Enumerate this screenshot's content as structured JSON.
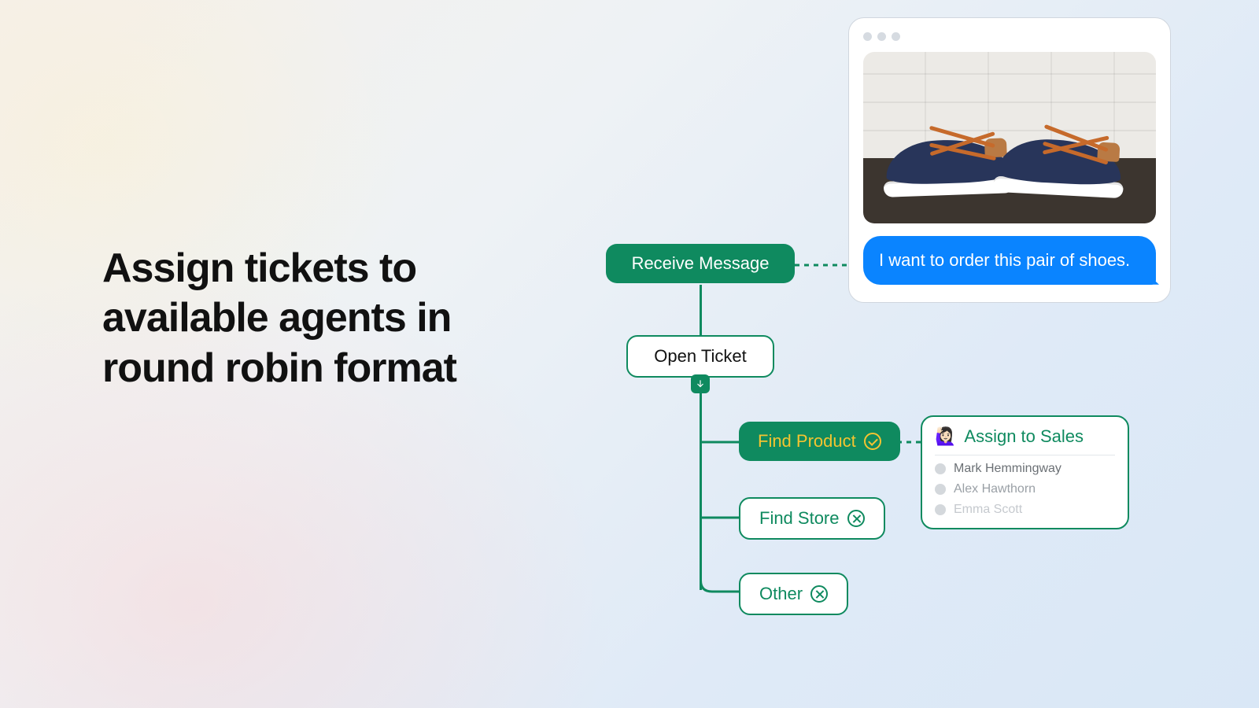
{
  "headline": "Assign tickets to available agents in round robin format",
  "chat": {
    "image_alt": "pair of navy canvas sneakers",
    "message": "I want to order this pair of shoes."
  },
  "flow": {
    "receive": "Receive Message",
    "open_ticket": "Open Ticket",
    "find_product": "Find Product",
    "find_store": "Find Store",
    "other": "Other"
  },
  "assign": {
    "title": "Assign to Sales",
    "emoji": "🙋🏻‍♀️",
    "agents": [
      "Mark Hemmingway",
      "Alex Hawthorn",
      "Emma Scott"
    ]
  },
  "colors": {
    "brand_green": "#0f8a5f",
    "accent_yellow": "#f4c430",
    "bubble_blue": "#0a84ff"
  }
}
